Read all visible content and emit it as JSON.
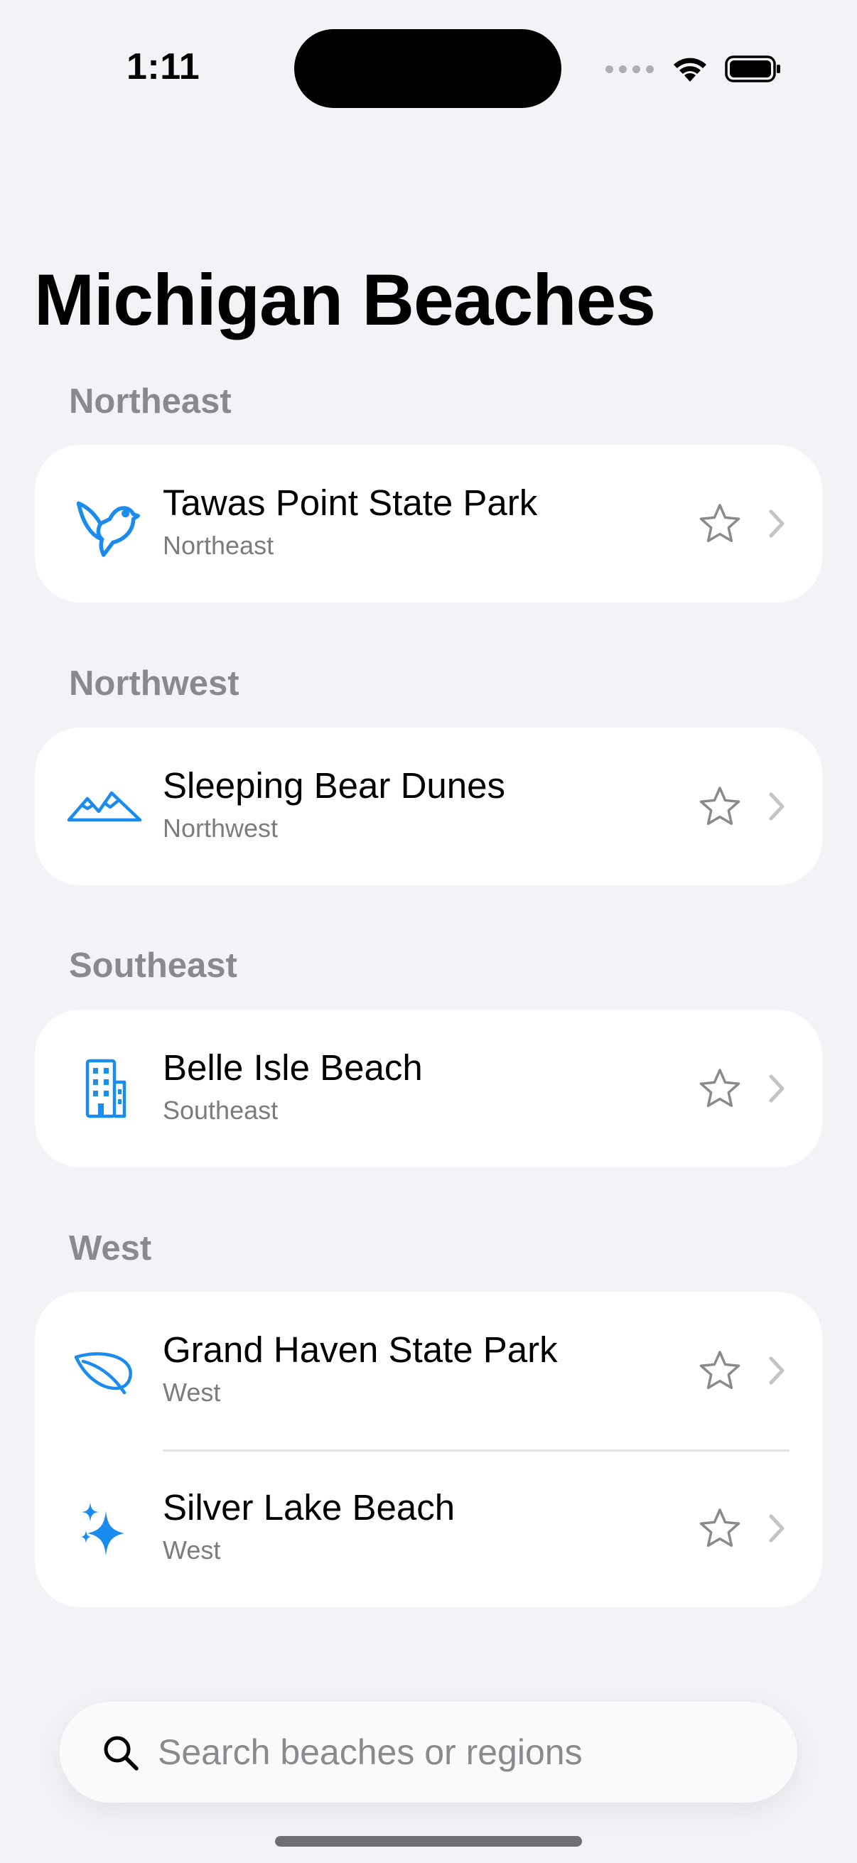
{
  "status": {
    "time": "1:11"
  },
  "title": "Michigan Beaches",
  "colors": {
    "accent": "#1a8cf0",
    "secondary": "#8a8a8e",
    "background": "#f2f2f7"
  },
  "sections": [
    {
      "header": "Northeast",
      "items": [
        {
          "name": "Tawas Point State Park",
          "region": "Northeast",
          "icon": "bird-icon"
        }
      ]
    },
    {
      "header": "Northwest",
      "items": [
        {
          "name": "Sleeping Bear Dunes",
          "region": "Northwest",
          "icon": "mountains-icon"
        }
      ]
    },
    {
      "header": "Southeast",
      "items": [
        {
          "name": "Belle Isle Beach",
          "region": "Southeast",
          "icon": "building-icon"
        }
      ]
    },
    {
      "header": "West",
      "items": [
        {
          "name": "Grand Haven State Park",
          "region": "West",
          "icon": "leaf-icon"
        },
        {
          "name": "Silver Lake Beach",
          "region": "West",
          "icon": "sparkles-icon"
        }
      ]
    }
  ],
  "search": {
    "placeholder": "Search beaches or regions",
    "value": ""
  }
}
